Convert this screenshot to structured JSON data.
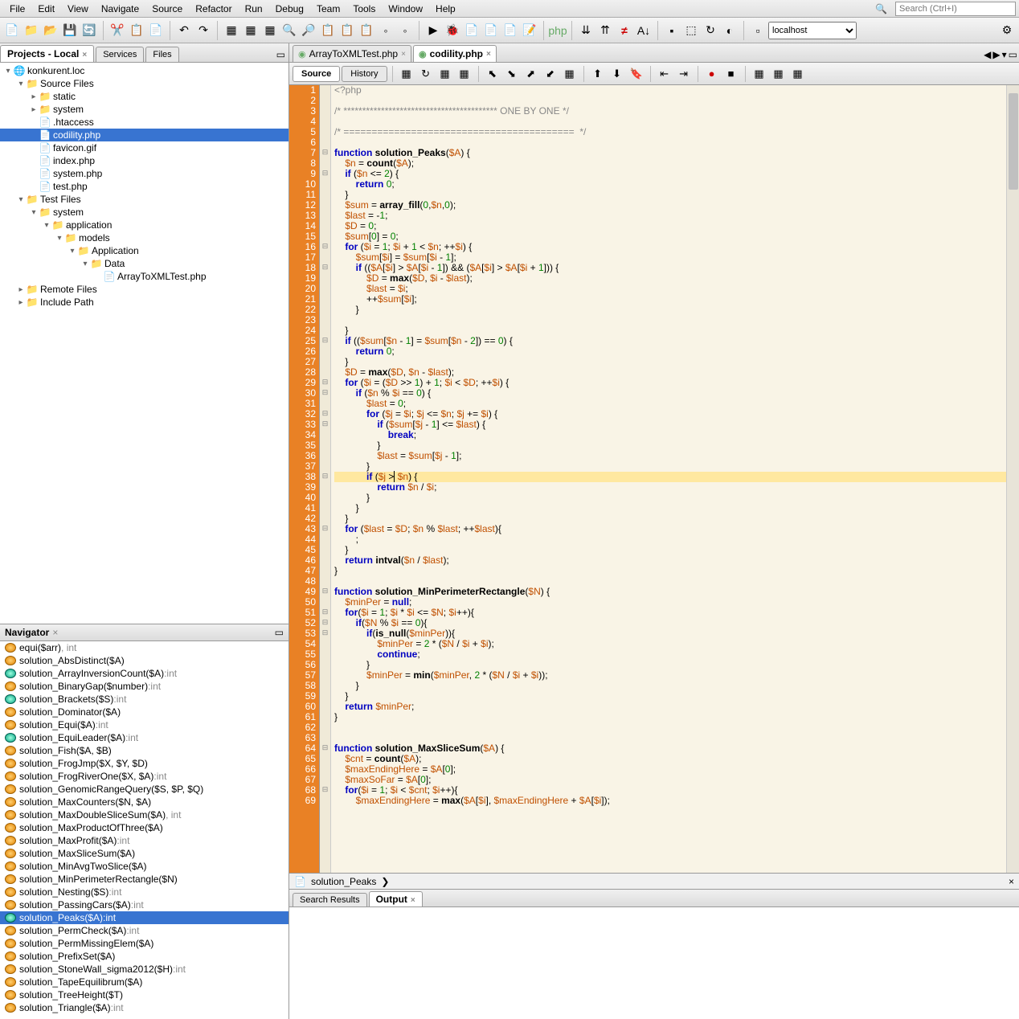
{
  "menu": [
    "File",
    "Edit",
    "View",
    "Navigate",
    "Source",
    "Refactor",
    "Run",
    "Debug",
    "Team",
    "Tools",
    "Window",
    "Help"
  ],
  "search_placeholder": "Search (Ctrl+I)",
  "hostSelect": "localhost",
  "projectPanel": {
    "tabs": [
      {
        "label": "Projects - Local",
        "active": true,
        "closable": true
      },
      {
        "label": "Services",
        "active": false
      },
      {
        "label": "Files",
        "active": false
      }
    ],
    "tree": [
      {
        "ind": 0,
        "tw": "▾",
        "ic": "🌐",
        "label": "konkurent.loc"
      },
      {
        "ind": 1,
        "tw": "▾",
        "ic": "📁",
        "label": "Source Files"
      },
      {
        "ind": 2,
        "tw": "▸",
        "ic": "📁",
        "label": "static"
      },
      {
        "ind": 2,
        "tw": "▸",
        "ic": "📁",
        "label": "system"
      },
      {
        "ind": 2,
        "tw": "",
        "ic": "📄",
        "label": ".htaccess"
      },
      {
        "ind": 2,
        "tw": "",
        "ic": "📄",
        "label": "codility.php",
        "selected": true
      },
      {
        "ind": 2,
        "tw": "",
        "ic": "📄",
        "label": "favicon.gif"
      },
      {
        "ind": 2,
        "tw": "",
        "ic": "📄",
        "label": "index.php"
      },
      {
        "ind": 2,
        "tw": "",
        "ic": "📄",
        "label": "system.php"
      },
      {
        "ind": 2,
        "tw": "",
        "ic": "📄",
        "label": "test.php"
      },
      {
        "ind": 1,
        "tw": "▾",
        "ic": "📁",
        "label": "Test Files"
      },
      {
        "ind": 2,
        "tw": "▾",
        "ic": "📁",
        "label": "system"
      },
      {
        "ind": 3,
        "tw": "▾",
        "ic": "📁",
        "label": "application"
      },
      {
        "ind": 4,
        "tw": "▾",
        "ic": "📁",
        "label": "models"
      },
      {
        "ind": 5,
        "tw": "▾",
        "ic": "📁",
        "label": "Application"
      },
      {
        "ind": 6,
        "tw": "▾",
        "ic": "📁",
        "label": "Data"
      },
      {
        "ind": 7,
        "tw": "",
        "ic": "📄",
        "label": "ArrayToXMLTest.php"
      },
      {
        "ind": 1,
        "tw": "▸",
        "ic": "📁",
        "label": "Remote Files"
      },
      {
        "ind": 1,
        "tw": "▸",
        "ic": "📁",
        "label": "Include Path"
      }
    ]
  },
  "navigator": {
    "title": "Navigator",
    "items": [
      {
        "b": "orange",
        "sig": "equi($arr)",
        "type": ", int"
      },
      {
        "b": "orange",
        "sig": "solution_AbsDistinct($A)",
        "type": ""
      },
      {
        "b": "teal",
        "sig": "solution_ArrayInversionCount($A)",
        "type": ":int"
      },
      {
        "b": "orange",
        "sig": "solution_BinaryGap($number)",
        "type": ":int"
      },
      {
        "b": "teal",
        "sig": "solution_Brackets($S)",
        "type": ":int"
      },
      {
        "b": "orange",
        "sig": "solution_Dominator($A)",
        "type": ""
      },
      {
        "b": "orange",
        "sig": "solution_Equi($A)",
        "type": ":int"
      },
      {
        "b": "teal",
        "sig": "solution_EquiLeader($A)",
        "type": ":int"
      },
      {
        "b": "orange",
        "sig": "solution_Fish($A, $B)",
        "type": ""
      },
      {
        "b": "orange",
        "sig": "solution_FrogJmp($X, $Y, $D)",
        "type": ""
      },
      {
        "b": "orange",
        "sig": "solution_FrogRiverOne($X, $A)",
        "type": ":int"
      },
      {
        "b": "orange",
        "sig": "solution_GenomicRangeQuery($S, $P, $Q)",
        "type": ""
      },
      {
        "b": "orange",
        "sig": "solution_MaxCounters($N, $A)",
        "type": ""
      },
      {
        "b": "orange",
        "sig": "solution_MaxDoubleSliceSum($A)",
        "type": ", int"
      },
      {
        "b": "orange",
        "sig": "solution_MaxProductOfThree($A)",
        "type": ""
      },
      {
        "b": "orange",
        "sig": "solution_MaxProfit($A)",
        "type": ":int"
      },
      {
        "b": "orange",
        "sig": "solution_MaxSliceSum($A)",
        "type": ""
      },
      {
        "b": "orange",
        "sig": "solution_MinAvgTwoSlice($A)",
        "type": ""
      },
      {
        "b": "orange",
        "sig": "solution_MinPerimeterRectangle($N)",
        "type": ""
      },
      {
        "b": "orange",
        "sig": "solution_Nesting($S)",
        "type": ":int"
      },
      {
        "b": "orange",
        "sig": "solution_PassingCars($A)",
        "type": ":int"
      },
      {
        "b": "teal",
        "sig": "solution_Peaks($A):int",
        "type": "",
        "selected": true
      },
      {
        "b": "orange",
        "sig": "solution_PermCheck($A)",
        "type": ":int"
      },
      {
        "b": "orange",
        "sig": "solution_PermMissingElem($A)",
        "type": ""
      },
      {
        "b": "orange",
        "sig": "solution_PrefixSet($A)",
        "type": ""
      },
      {
        "b": "orange",
        "sig": "solution_StoneWall_sigma2012($H)",
        "type": ":int"
      },
      {
        "b": "orange",
        "sig": "solution_TapeEquilibrum($A)",
        "type": ""
      },
      {
        "b": "orange",
        "sig": "solution_TreeHeight($T)",
        "type": ""
      },
      {
        "b": "orange",
        "sig": "solution_Triangle($A)",
        "type": ":int"
      }
    ]
  },
  "editorTabs": [
    {
      "label": "ArrayToXMLTest.php",
      "active": false
    },
    {
      "label": "codility.php",
      "active": true
    }
  ],
  "editorModes": {
    "source": "Source",
    "history": "History"
  },
  "breadcrumb": "solution_Peaks",
  "bottomTabs": [
    {
      "label": "Search Results",
      "active": false
    },
    {
      "label": "Output",
      "active": true,
      "closable": true
    }
  ],
  "codeLines": [
    "<span class='c'>&lt;?php</span>",
    "",
    "<span class='c'>/* ***************************************** ONE BY ONE */</span>",
    "",
    "<span class='c'>/* =========================================  */</span>",
    "",
    "<span class='k'>function</span> <span class='fn'>solution_Peaks</span>(<span class='v'>$A</span>) {",
    "    <span class='v'>$n</span> = <span class='fn'>count</span>(<span class='v'>$A</span>);",
    "    <span class='k'>if</span> (<span class='v'>$n</span> &lt;= <span class='n'>2</span>) {",
    "        <span class='k'>return</span> <span class='n'>0</span>;",
    "    }",
    "    <span class='v'>$sum</span> = <span class='fn'>array_fill</span>(<span class='n'>0</span>,<span class='v'>$n</span>,<span class='n'>0</span>);",
    "    <span class='v'>$last</span> = -<span class='n'>1</span>;",
    "    <span class='v'>$D</span> = <span class='n'>0</span>;",
    "    <span class='v'>$sum</span>[<span class='n'>0</span>] = <span class='n'>0</span>;",
    "    <span class='k'>for</span> (<span class='v'>$i</span> = <span class='n'>1</span>; <span class='v'>$i</span> + <span class='n'>1</span> &lt; <span class='v'>$n</span>; ++<span class='v'>$i</span>) {",
    "        <span class='v'>$sum</span>[<span class='v'>$i</span>] = <span class='v'>$sum</span>[<span class='v'>$i</span> - <span class='n'>1</span>];",
    "        <span class='k'>if</span> ((<span class='v'>$A</span>[<span class='v'>$i</span>] &gt; <span class='v'>$A</span>[<span class='v'>$i</span> - <span class='n'>1</span>]) &amp;&amp; (<span class='v'>$A</span>[<span class='v'>$i</span>] &gt; <span class='v'>$A</span>[<span class='v'>$i</span> + <span class='n'>1</span>])) {",
    "            <span class='v'>$D</span> = <span class='fn'>max</span>(<span class='v'>$D</span>, <span class='v'>$i</span> - <span class='v'>$last</span>);",
    "            <span class='v'>$last</span> = <span class='v'>$i</span>;",
    "            ++<span class='v'>$sum</span>[<span class='v'>$i</span>];",
    "        }",
    "",
    "    }",
    "    <span class='k'>if</span> ((<span class='v'>$sum</span>[<span class='v'>$n</span> - <span class='n'>1</span>] = <span class='v'>$sum</span>[<span class='v'>$n</span> - <span class='n'>2</span>]) == <span class='n'>0</span>) {",
    "        <span class='k'>return</span> <span class='n'>0</span>;",
    "    }",
    "    <span class='v'>$D</span> = <span class='fn'>max</span>(<span class='v'>$D</span>, <span class='v'>$n</span> - <span class='v'>$last</span>);",
    "    <span class='k'>for</span> (<span class='v'>$i</span> = (<span class='v'>$D</span> &gt;&gt; <span class='n'>1</span>) + <span class='n'>1</span>; <span class='v'>$i</span> &lt; <span class='v'>$D</span>; ++<span class='v'>$i</span>) {",
    "        <span class='k'>if</span> (<span class='v'>$n</span> % <span class='v'>$i</span> == <span class='n'>0</span>) {",
    "            <span class='v'>$last</span> = <span class='n'>0</span>;",
    "            <span class='k'>for</span> (<span class='v'>$j</span> = <span class='v'>$i</span>; <span class='v'>$j</span> &lt;= <span class='v'>$n</span>; <span class='v'>$j</span> += <span class='v'>$i</span>) {",
    "                <span class='k'>if</span> (<span class='v'>$sum</span>[<span class='v'>$j</span> - <span class='n'>1</span>] &lt;= <span class='v'>$last</span>) {",
    "                    <span class='k'>break</span>;",
    "                }",
    "                <span class='v'>$last</span> = <span class='v'>$sum</span>[<span class='v'>$j</span> - <span class='n'>1</span>];",
    "            }",
    "            <span class='k'>if</span> (<span class='v'>$j</span> &gt;<span style='border-left:1px solid #000'></span> <span class='v'>$n</span>) {",
    "                <span class='k'>return</span> <span class='v'>$n</span> / <span class='v'>$i</span>;",
    "            }",
    "        }",
    "    }",
    "    <span class='k'>for</span> (<span class='v'>$last</span> = <span class='v'>$D</span>; <span class='v'>$n</span> % <span class='v'>$last</span>; ++<span class='v'>$last</span>){",
    "        ;",
    "    }",
    "    <span class='k'>return</span> <span class='fn'>intval</span>(<span class='v'>$n</span> / <span class='v'>$last</span>);",
    "}",
    "",
    "<span class='k'>function</span> <span class='fn'>solution_MinPerimeterRectangle</span>(<span class='v'>$N</span>) {",
    "    <span class='v'>$minPer</span> = <span class='k'>null</span>;",
    "    <span class='k'>for</span>(<span class='v'>$i</span> = <span class='n'>1</span>; <span class='v'>$i</span> * <span class='v'>$i</span> &lt;= <span class='v'>$N</span>; <span class='v'>$i</span>++){",
    "        <span class='k'>if</span>(<span class='v'>$N</span> % <span class='v'>$i</span> == <span class='n'>0</span>){",
    "            <span class='k'>if</span>(<span class='fn'>is_null</span>(<span class='v'>$minPer</span>)){",
    "                <span class='v'>$minPer</span> = <span class='n'>2</span> * (<span class='v'>$N</span> / <span class='v'>$i</span> + <span class='v'>$i</span>);",
    "                <span class='k'>continue</span>;",
    "            }",
    "            <span class='v'>$minPer</span> = <span class='fn'>min</span>(<span class='v'>$minPer</span>, <span class='n'>2</span> * (<span class='v'>$N</span> / <span class='v'>$i</span> + <span class='v'>$i</span>));",
    "        }",
    "    }",
    "    <span class='k'>return</span> <span class='v'>$minPer</span>;",
    "}",
    "",
    "",
    "<span class='k'>function</span> <span class='fn'>solution_MaxSliceSum</span>(<span class='v'>$A</span>) {",
    "    <span class='v'>$cnt</span> = <span class='fn'>count</span>(<span class='v'>$A</span>);",
    "    <span class='v'>$maxEndingHere</span> = <span class='v'>$A</span>[<span class='n'>0</span>];",
    "    <span class='v'>$maxSoFar</span> = <span class='v'>$A</span>[<span class='n'>0</span>];",
    "    <span class='k'>for</span>(<span class='v'>$i</span> = <span class='n'>1</span>; <span class='v'>$i</span> &lt; <span class='v'>$cnt</span>; <span class='v'>$i</span>++){",
    "        <span class='v'>$maxEndingHere</span> = <span class='fn'>max</span>(<span class='v'>$A</span>[<span class='v'>$i</span>], <span class='v'>$maxEndingHere</span> + <span class='v'>$A</span>[<span class='v'>$i</span>]);"
  ],
  "highlightLine": 37
}
